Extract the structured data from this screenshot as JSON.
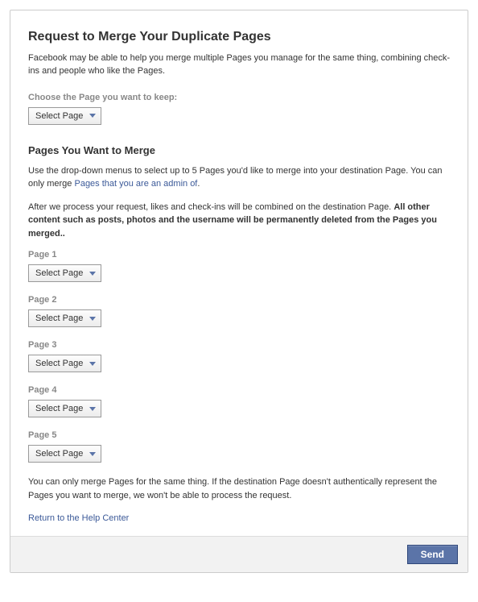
{
  "heading": "Request to Merge Your Duplicate Pages",
  "lead": "Facebook may be able to help you merge multiple Pages you manage for the same thing, combining check-ins and people who like the Pages.",
  "keep_label": "Choose the Page you want to keep:",
  "dropdown_text": "Select Page",
  "merge_heading": "Pages You Want to Merge",
  "merge_intro_prefix": "Use the drop-down menus to select up to 5 Pages you'd like to merge into your destination Page. You can only merge ",
  "merge_intro_link": "Pages that you are an admin of",
  "merge_intro_suffix": ".",
  "process_note_plain": "After we process your request, likes and check-ins will be combined on the destination Page. ",
  "process_note_bold": "All other content such as posts, photos and the username will be permanently deleted from the Pages you merged..",
  "fields": {
    "p1": "Page 1",
    "p2": "Page 2",
    "p3": "Page 3",
    "p4": "Page 4",
    "p5": "Page 5"
  },
  "auth_note": "You can only merge Pages for the same thing. If the destination Page doesn't authentically represent the Pages you want to merge, we won't be able to process the request.",
  "help_link": "Return to the Help Center",
  "send_label": "Send"
}
